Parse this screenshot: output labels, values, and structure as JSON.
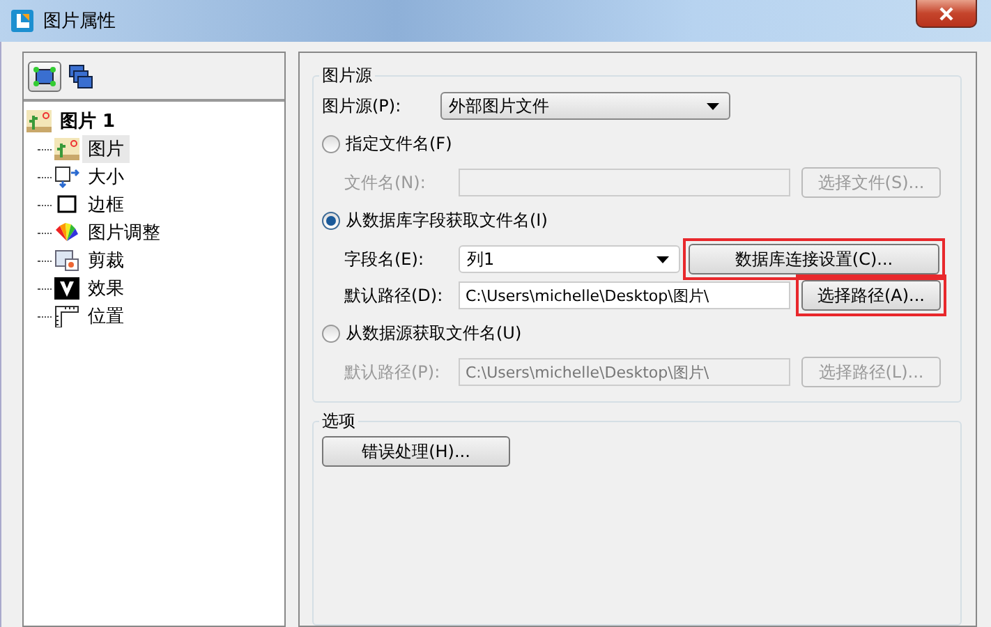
{
  "window": {
    "title": "图片属性"
  },
  "toolbar": [
    {
      "selected": true
    },
    {
      "selected": false
    }
  ],
  "tree": {
    "label": "图片 1",
    "children": [
      {
        "label": "图片",
        "selected": true
      },
      {
        "label": "大小",
        "selected": false
      },
      {
        "label": "边框",
        "selected": false
      },
      {
        "label": "图片调整",
        "selected": false
      },
      {
        "label": "剪裁",
        "selected": false
      },
      {
        "label": "效果",
        "selected": false
      },
      {
        "label": "位置",
        "selected": false
      }
    ]
  },
  "source_group": {
    "title": "图片源",
    "source": {
      "label": "图片源(P):",
      "value": "外部图片文件"
    },
    "options": [
      {
        "label": "指定文件名(F)",
        "selected": false,
        "rows": [
          {
            "kind": "field",
            "label": "文件名(N):",
            "disabled": true,
            "button": {
              "label": "选择文件(S)...",
              "highlighted": false
            }
          }
        ]
      },
      {
        "label": "从数据库字段获取文件名(I)",
        "selected": true,
        "rows": [
          {
            "kind": "select",
            "label": "字段名(E):",
            "value": "列1",
            "disabled": false,
            "button": {
              "label": "数据库连接设置(C)...",
              "highlighted": true
            }
          },
          {
            "kind": "field",
            "label": "默认路径(D):",
            "value": "C:\\Users\\michelle\\Desktop\\图片\\",
            "disabled": false,
            "button": {
              "label": "选择路径(A)...",
              "highlighted": true
            }
          }
        ]
      },
      {
        "label": "从数据源获取文件名(U)",
        "selected": false,
        "rows": [
          {
            "kind": "field",
            "label": "默认路径(P):",
            "value": "C:\\Users\\michelle\\Desktop\\图片\\",
            "disabled": true,
            "button": {
              "label": "选择路径(L)...",
              "highlighted": false
            }
          }
        ]
      }
    ]
  },
  "options_group": {
    "title": "选项",
    "button": "错误处理(H)..."
  }
}
